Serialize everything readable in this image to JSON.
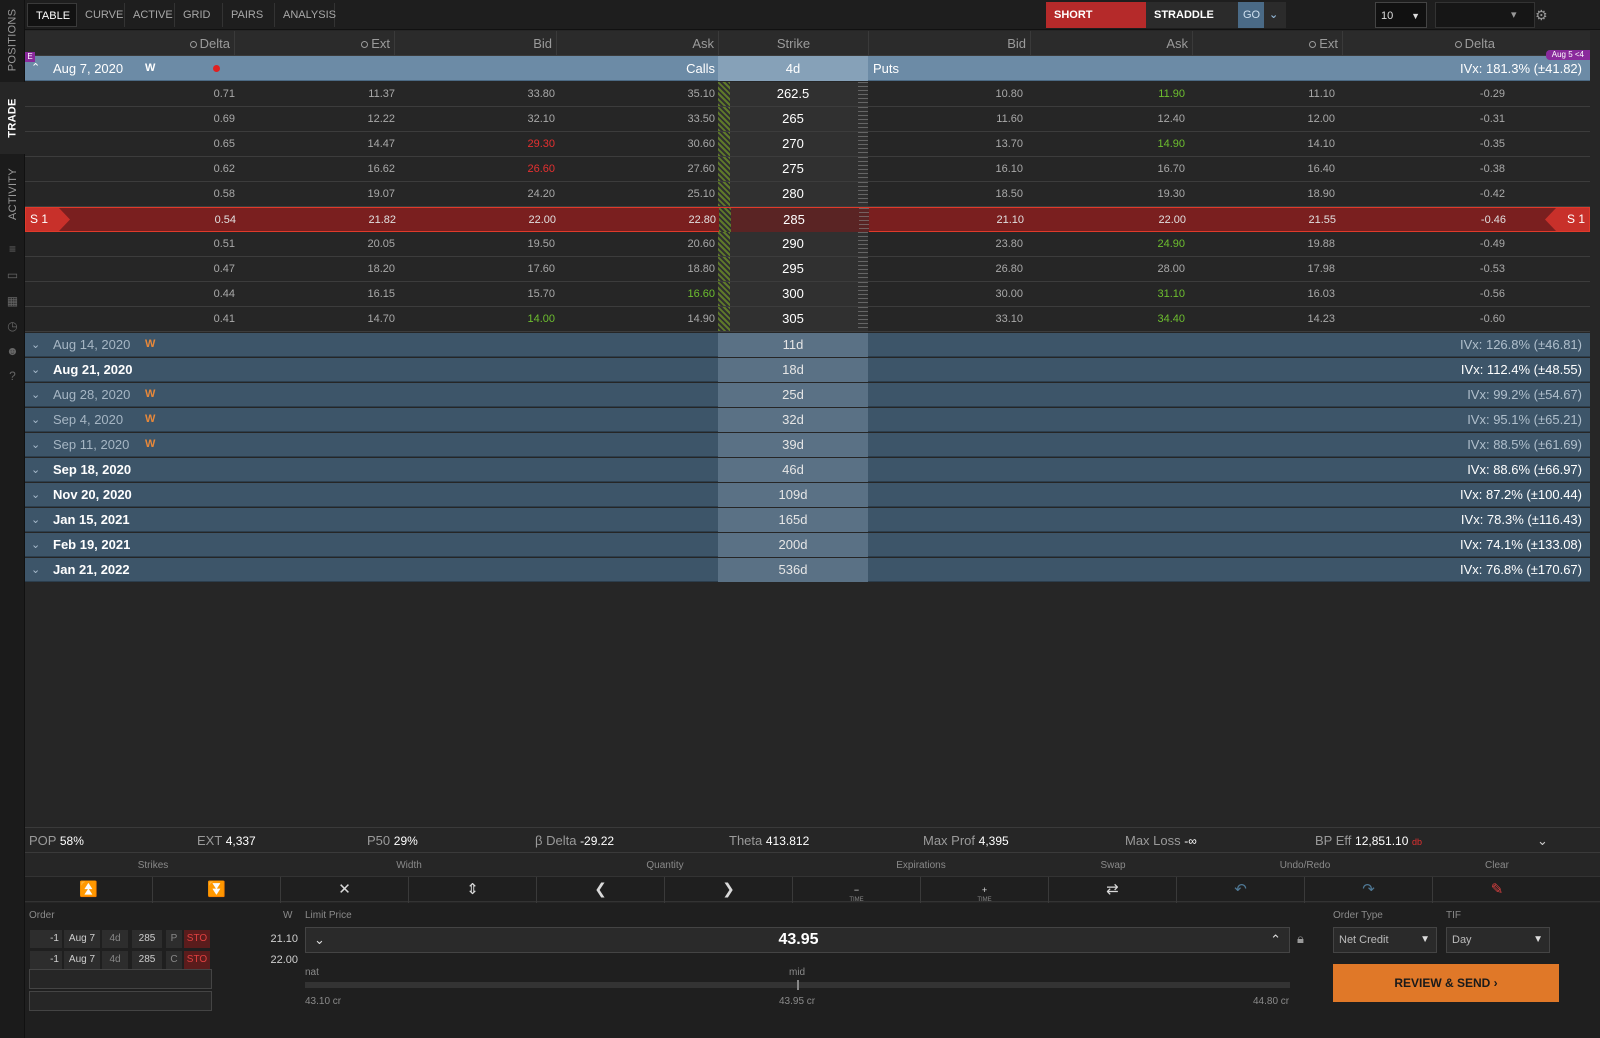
{
  "leftnav": {
    "tabs": [
      {
        "label": "POSITIONS",
        "active": false
      },
      {
        "label": "TRADE",
        "active": true
      },
      {
        "label": "ACTIVITY",
        "active": false
      }
    ]
  },
  "toolbar": {
    "tabs": [
      "TABLE",
      "CURVE",
      "ACTIVE",
      "GRID",
      "PAIRS",
      "ANALYSIS"
    ],
    "active_tab": "TABLE",
    "direction": "SHORT",
    "strategy": "STRADDLE",
    "go": "GO",
    "strikes_count": "10"
  },
  "columns": {
    "call": [
      "Delta",
      "Ext",
      "Bid",
      "Ask"
    ],
    "strike": "Strike",
    "put": [
      "Bid",
      "Ask",
      "Ext",
      "Delta"
    ]
  },
  "expanded": {
    "date": "Aug 7, 2020",
    "weekly": "W",
    "calls": "Calls",
    "days": "4d",
    "puts": "Puts",
    "ivx": "IVx: 181.3% (±41.82)",
    "flag_left": "E",
    "flag_right": "Aug 5 <4",
    "position_marker": "S 1"
  },
  "rows": [
    {
      "c_delta": "0.71",
      "c_ext": "11.37",
      "c_bid": "33.80",
      "c_ask": "35.10",
      "strike": "262.5",
      "p_bid": "10.80",
      "p_ask": "11.90",
      "p_ext": "11.10",
      "p_delta": "-0.29",
      "c_bid_color": "",
      "c_ask_color": "",
      "p_ask_color": "grn"
    },
    {
      "c_delta": "0.69",
      "c_ext": "12.22",
      "c_bid": "32.10",
      "c_ask": "33.50",
      "strike": "265",
      "p_bid": "11.60",
      "p_ask": "12.40",
      "p_ext": "12.00",
      "p_delta": "-0.31",
      "c_bid_color": "",
      "c_ask_color": "",
      "p_ask_color": ""
    },
    {
      "c_delta": "0.65",
      "c_ext": "14.47",
      "c_bid": "29.30",
      "c_ask": "30.60",
      "strike": "270",
      "p_bid": "13.70",
      "p_ask": "14.90",
      "p_ext": "14.10",
      "p_delta": "-0.35",
      "c_bid_color": "red",
      "c_ask_color": "",
      "p_ask_color": "grn"
    },
    {
      "c_delta": "0.62",
      "c_ext": "16.62",
      "c_bid": "26.60",
      "c_ask": "27.60",
      "strike": "275",
      "p_bid": "16.10",
      "p_ask": "16.70",
      "p_ext": "16.40",
      "p_delta": "-0.38",
      "c_bid_color": "red",
      "c_ask_color": "",
      "p_ask_color": ""
    },
    {
      "c_delta": "0.58",
      "c_ext": "19.07",
      "c_bid": "24.20",
      "c_ask": "25.10",
      "strike": "280",
      "p_bid": "18.50",
      "p_ask": "19.30",
      "p_ext": "18.90",
      "p_delta": "-0.42",
      "c_bid_color": "",
      "c_ask_color": "",
      "p_ask_color": ""
    },
    {
      "c_delta": "0.54",
      "c_ext": "21.82",
      "c_bid": "22.00",
      "c_ask": "22.80",
      "strike": "285",
      "p_bid": "21.10",
      "p_ask": "22.00",
      "p_ext": "21.55",
      "p_delta": "-0.46",
      "c_bid_color": "",
      "c_ask_color": "",
      "p_ask_color": "",
      "selected": true
    },
    {
      "c_delta": "0.51",
      "c_ext": "20.05",
      "c_bid": "19.50",
      "c_ask": "20.60",
      "strike": "290",
      "p_bid": "23.80",
      "p_ask": "24.90",
      "p_ext": "19.88",
      "p_delta": "-0.49",
      "c_bid_color": "",
      "c_ask_color": "",
      "p_ask_color": "grn"
    },
    {
      "c_delta": "0.47",
      "c_ext": "18.20",
      "c_bid": "17.60",
      "c_ask": "18.80",
      "strike": "295",
      "p_bid": "26.80",
      "p_ask": "28.00",
      "p_ext": "17.98",
      "p_delta": "-0.53",
      "c_bid_color": "",
      "c_ask_color": "",
      "p_ask_color": ""
    },
    {
      "c_delta": "0.44",
      "c_ext": "16.15",
      "c_bid": "15.70",
      "c_ask": "16.60",
      "strike": "300",
      "p_bid": "30.00",
      "p_ask": "31.10",
      "p_ext": "16.03",
      "p_delta": "-0.56",
      "c_bid_color": "",
      "c_ask_color": "grn",
      "p_ask_color": "grn"
    },
    {
      "c_delta": "0.41",
      "c_ext": "14.70",
      "c_bid": "14.00",
      "c_ask": "14.90",
      "strike": "305",
      "p_bid": "33.10",
      "p_ask": "34.40",
      "p_ext": "14.23",
      "p_delta": "-0.60",
      "c_bid_color": "grn",
      "c_ask_color": "",
      "p_ask_color": "grn"
    }
  ],
  "expirations": [
    {
      "date": "Aug 14, 2020",
      "weekly": "W",
      "days": "11d",
      "ivx": "IVx: 126.8% (±46.81)",
      "bold": false
    },
    {
      "date": "Aug 21, 2020",
      "weekly": "",
      "days": "18d",
      "ivx": "IVx: 112.4% (±48.55)",
      "bold": true
    },
    {
      "date": "Aug 28, 2020",
      "weekly": "W",
      "days": "25d",
      "ivx": "IVx: 99.2% (±54.67)",
      "bold": false
    },
    {
      "date": "Sep 4, 2020",
      "weekly": "W",
      "days": "32d",
      "ivx": "IVx: 95.1% (±65.21)",
      "bold": false
    },
    {
      "date": "Sep 11, 2020",
      "weekly": "W",
      "days": "39d",
      "ivx": "IVx: 88.5% (±61.69)",
      "bold": false
    },
    {
      "date": "Sep 18, 2020",
      "weekly": "",
      "days": "46d",
      "ivx": "IVx: 88.6% (±66.97)",
      "bold": true
    },
    {
      "date": "Nov 20, 2020",
      "weekly": "",
      "days": "109d",
      "ivx": "IVx: 87.2% (±100.44)",
      "bold": true
    },
    {
      "date": "Jan 15, 2021",
      "weekly": "",
      "days": "165d",
      "ivx": "IVx: 78.3% (±116.43)",
      "bold": true
    },
    {
      "date": "Feb 19, 2021",
      "weekly": "",
      "days": "200d",
      "ivx": "IVx: 74.1% (±133.08)",
      "bold": true
    },
    {
      "date": "Jan 21, 2022",
      "weekly": "",
      "days": "536d",
      "ivx": "IVx: 76.8% (±170.67)",
      "bold": true
    }
  ],
  "summary": {
    "pop_label": "POP",
    "pop": "58%",
    "ext_label": "EXT",
    "ext": "4,337",
    "p50_label": "P50",
    "p50": "29%",
    "bdelta_label": "β Delta",
    "bdelta": "-29.22",
    "theta_label": "Theta",
    "theta": "413.812",
    "maxprof_label": "Max Prof",
    "maxprof": "4,395",
    "maxloss_label": "Max Loss",
    "maxloss": "-∞",
    "bpeff_label": "BP Eff",
    "bpeff": "12,851.10",
    "bpeff_suffix": "db"
  },
  "controls": {
    "labels": [
      "Strikes",
      "Width",
      "Quantity",
      "Expirations",
      "Swap",
      "Undo/Redo",
      "Clear"
    ],
    "time_label": "TIME"
  },
  "order": {
    "title": "Order",
    "w_label": "W",
    "legs": [
      {
        "qty": "-1",
        "exp": "Aug 7",
        "days": "4d",
        "strike": "285",
        "type": "P",
        "action": "STO",
        "price": "21.10"
      },
      {
        "qty": "-1",
        "exp": "Aug 7",
        "days": "4d",
        "strike": "285",
        "type": "C",
        "action": "STO",
        "price": "22.00"
      }
    ],
    "limit_label": "Limit Price",
    "limit_price": "43.95",
    "nat_label": "nat",
    "mid_label": "mid",
    "nat_value": "43.10 cr",
    "mid_value": "43.95 cr",
    "far_value": "44.80 cr",
    "order_type_label": "Order Type",
    "order_type": "Net Credit",
    "tif_label": "TIF",
    "tif": "Day",
    "review_button": "REVIEW & SEND"
  }
}
